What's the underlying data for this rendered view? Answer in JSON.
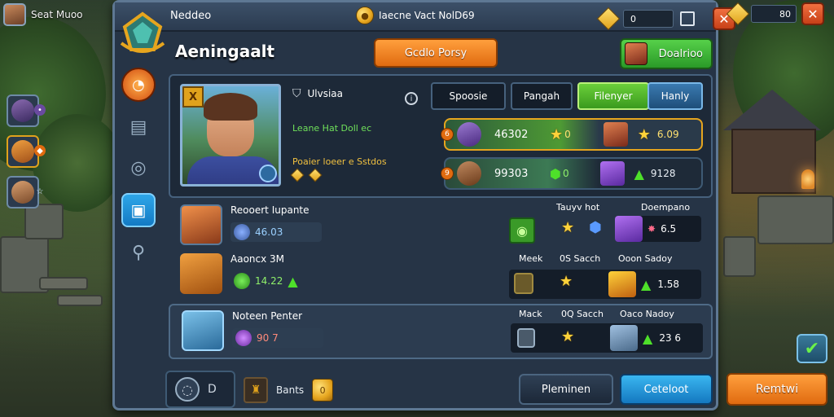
{
  "player": {
    "name": "Seat Muoo"
  },
  "topbar": {
    "title": "Neddeo",
    "center_text": "Iaecne Vact NolD69",
    "currency_value": "0",
    "right_currency_value": "80"
  },
  "panel": {
    "heading": "Aeningaalt",
    "orange_button": "Gcdlo Porsy",
    "green_button": "Doalrioo"
  },
  "hero": {
    "corner_badge": "X",
    "name": "Ulvsiaa",
    "stat_line_1": "Leane Hat Doll ec",
    "stat_line_2": "Poaier loeer e Sstdos"
  },
  "tabs": [
    {
      "label": "Spoosie"
    },
    {
      "label": "Pangah"
    },
    {
      "label": "Filenyer"
    },
    {
      "label": "Hanly"
    }
  ],
  "stat_rows": [
    {
      "badge": "6",
      "value": "46302",
      "stars": "0",
      "right_value": "6.09"
    },
    {
      "badge": "9",
      "value": "99303",
      "stars": "0",
      "right_value": "9128"
    }
  ],
  "list": {
    "header_col1": "Tauyv hot",
    "header_col2": "Doempano",
    "rows": [
      {
        "title": "Reooert Iupante",
        "pill_value": "46.03",
        "value": "6.5"
      },
      {
        "title": "Aaoncx 3M",
        "pill_value": "14.22",
        "col_a": "Meek",
        "col_b": "0S Sacch",
        "col_c": "Ooon Sadoy",
        "value": "1.58"
      },
      {
        "title": "Noteen Penter",
        "pill_value": "90 7",
        "col_a": "Mack",
        "col_b": "0Q Sacch",
        "col_c": "Oaco Nadoy",
        "value": "23 6"
      }
    ]
  },
  "bottom": {
    "icon_label": "D",
    "resource_label": "Bants",
    "resource_value": "0",
    "btn_dark": "Pleminen",
    "btn_blue": "Ceteloot"
  },
  "right": {
    "action_button": "Remtwi"
  },
  "colors": {
    "accent_orange": "#e06b10",
    "accent_green": "#3a9a1e",
    "accent_blue": "#1478c0",
    "panel_bg": "#263446"
  }
}
